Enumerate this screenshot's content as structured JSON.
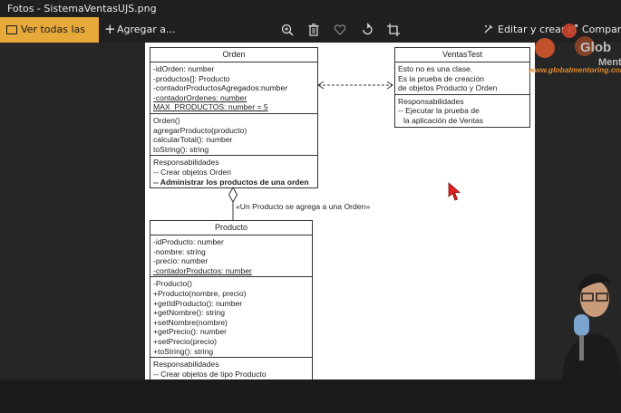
{
  "window": {
    "title": "Fotos - SistemaVentasUJS.png"
  },
  "toolbar": {
    "view_all_label": "Ver todas las fotos",
    "add_label": "Agregar a...",
    "edit_label": "Editar y crear",
    "share_label": "Compartir",
    "icons": [
      "zoom-icon",
      "delete-icon",
      "favorite-icon",
      "rotate-icon",
      "crop-icon"
    ]
  },
  "diagram": {
    "orden": {
      "title": "Orden",
      "attributes": [
        "-idOrden: number",
        "-productos[]: Producto",
        "-contadorProductosAgregados:number"
      ],
      "static_attributes": [
        "-contadorOrdenes: number",
        "MAX_PRODUCTOS: number = 5"
      ],
      "methods": [
        "Orden()",
        "agregarProducto(producto)",
        "calcularTotal(): number",
        "toString(): string"
      ],
      "responsibilities_title": "Responsabilidades",
      "responsibility_1": "-- Crear objetos Orden",
      "responsibility_2": "-- Administrar los productos de una orden"
    },
    "ventastest": {
      "title": "VentasTest",
      "notes": [
        "Esto no es una clase.",
        "Es la prueba de creación",
        "de objetos Producto y Orden"
      ],
      "responsibilities_title": "Responsabilidades",
      "responsibilities": [
        "-- Ejecutar la prueba de",
        "   la aplicación de Ventas"
      ]
    },
    "producto": {
      "title": "Producto",
      "attributes": [
        "-idProducto: number",
        "-nombre: string",
        "-precio: number"
      ],
      "static_attribute": "-contadorProductos: number",
      "methods": [
        "-Producto()",
        "+Producto(nombre, precio)",
        "+getIdProducto(): number",
        "+getNombre(): string",
        "+setNombre(nombre)",
        "+getPrecio(): number",
        "+setPrecio(precio)",
        "+toString(): string"
      ],
      "responsibilities_title": "Responsabilidades",
      "responsibilities": [
        "-- Crear objetos de tipo Producto"
      ]
    },
    "association_label": "«Un Producto se agrega a una Orden»"
  },
  "overlay": {
    "logo_text": "Glob",
    "logo_text_2": "Ment",
    "logo_url": "www.globalmentoring.com",
    "brand_color": "#e08a2a"
  }
}
